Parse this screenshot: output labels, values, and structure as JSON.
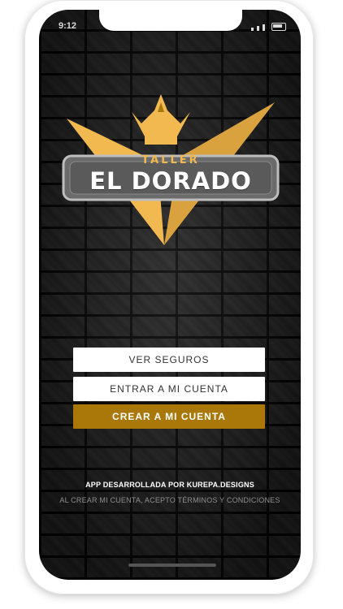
{
  "status_bar": {
    "time": "9:12"
  },
  "logo": {
    "small_text": "TALLER",
    "big_text": "EL DORADO",
    "icon": "crown-shield-logo"
  },
  "actions": {
    "ver_seguros": "VER SEGUROS",
    "entrar": "ENTRAR A MI CUENTA",
    "crear": "CREAR A MI CUENTA"
  },
  "footer": {
    "credit": "APP DESARROLLADA POR KUREPA.DESIGNS",
    "terms": "AL CREAR MI CUENTA, ACEPTO TÉRMINOS Y CONDICIONES"
  },
  "colors": {
    "gold": "#f2b950",
    "button_gold": "#a97808",
    "background": "#1b1b1b"
  }
}
